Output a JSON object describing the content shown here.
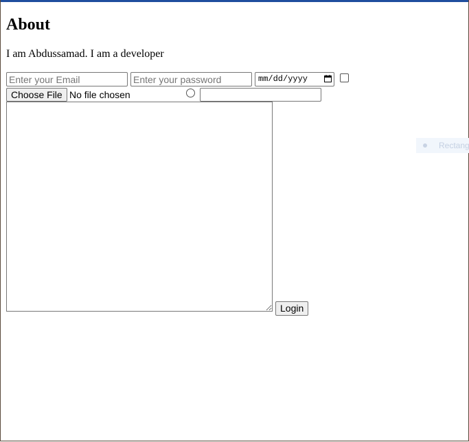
{
  "page": {
    "heading": "About",
    "intro": "I am Abdussamad. I am a developer"
  },
  "form": {
    "email_placeholder": "Enter your Email",
    "password_placeholder": "Enter your password",
    "date_placeholder": "mm/dd/yyyy",
    "file_button_label": "Choose File",
    "file_status": "No file chosen",
    "login_label": "Login"
  },
  "overlay": {
    "ghost_label": "Rectang"
  },
  "icons": {
    "calendar": "calendar-icon",
    "ghost_marker": "dot-icon"
  },
  "colors": {
    "top_accent": "#1f4e9e"
  }
}
